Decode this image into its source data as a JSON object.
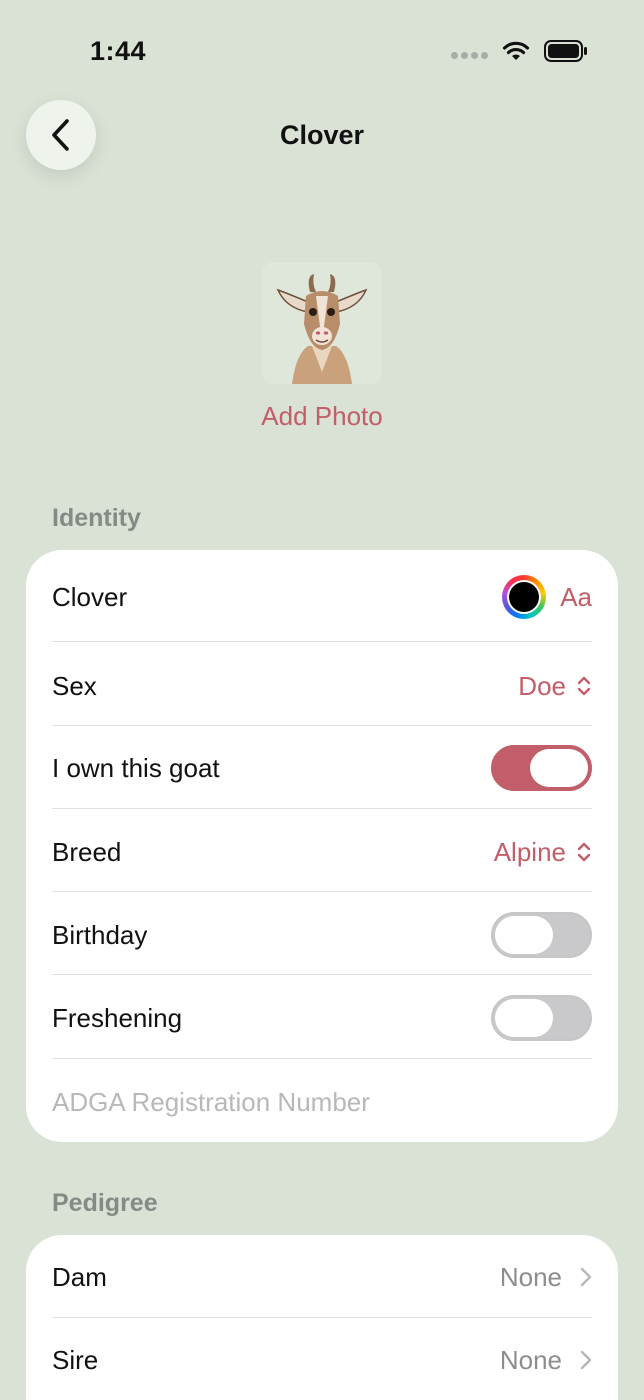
{
  "status_bar": {
    "time": "1:44"
  },
  "nav": {
    "title": "Clover",
    "back_icon": "chevron-left-icon"
  },
  "photo": {
    "add_label": "Add Photo"
  },
  "identity": {
    "header": "Identity",
    "name_value": "Clover",
    "font_label": "Aa",
    "sex_label": "Sex",
    "sex_value": "Doe",
    "own_label": "I own this goat",
    "own_on": true,
    "breed_label": "Breed",
    "breed_value": "Alpine",
    "birthday_label": "Birthday",
    "birthday_on": false,
    "freshening_label": "Freshening",
    "freshening_on": false,
    "registration_placeholder": "ADGA Registration Number"
  },
  "pedigree": {
    "header": "Pedigree",
    "dam_label": "Dam",
    "dam_value": "None",
    "sire_label": "Sire",
    "sire_value": "None"
  },
  "colors": {
    "accent": "#c25e69",
    "background": "#d9e2d5"
  }
}
